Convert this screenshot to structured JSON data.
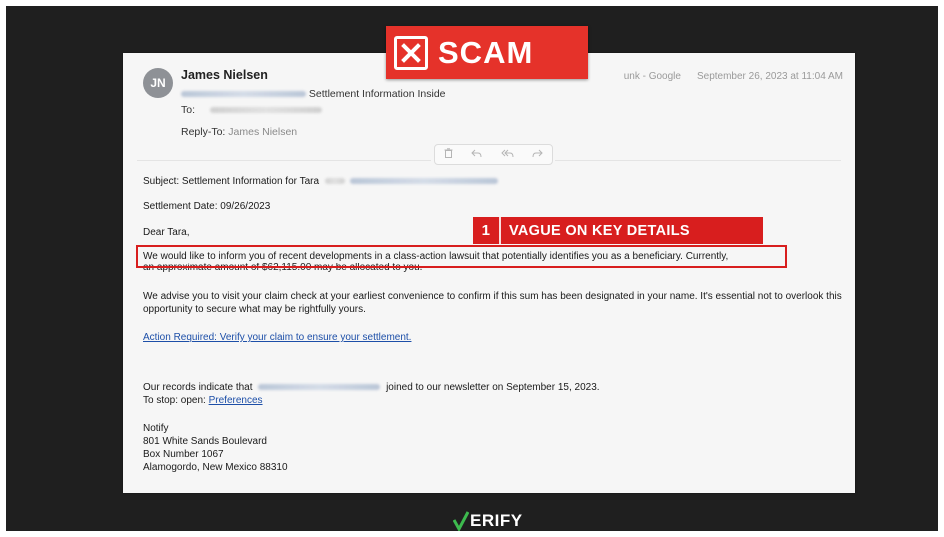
{
  "badge": {
    "scam_label": "SCAM"
  },
  "annotation": {
    "number": "1",
    "label": "VAGUE ON KEY DETAILS"
  },
  "email": {
    "avatar_initials": "JN",
    "sender_name": "James Nielsen",
    "from_meta_partial": "unk - Google",
    "date": "September 26, 2023 at 11:04 AM",
    "subject_preview": "Settlement Information Inside",
    "to_label": "To:",
    "reply_to_label": "Reply-To:",
    "reply_to_value": "James Nielsen",
    "subject_line": "Subject: Settlement Information for Tara",
    "settlement_date": "Settlement Date: 09/26/2023",
    "greeting": "Dear Tara,",
    "para1_highlighted": "We would like to inform you of recent developments in a class-action lawsuit that potentially identifies you as a beneficiary.",
    "para1_rest": "Currently,",
    "para1_line2": "an approximate amount of $62,115.00 may be allocated to you.",
    "para2": "We advise you to visit your claim check at your earliest convenience to confirm if this sum has been designated in your name. It's essential not to overlook this opportunity to secure what may be rightfully yours.",
    "action_link": "Action Required: Verify your claim to ensure your settlement.",
    "records_prefix": "Our records indicate that",
    "records_suffix": "joined to our newsletter on September 15, 2023.",
    "stop_prefix": "To stop: open:",
    "preferences_link": "Preferences",
    "signature": {
      "company": "Notify",
      "address1": "801 White Sands Boulevard",
      "address2": "Box Number 1067",
      "address3": "Alamogordo, New Mexico 88310"
    }
  },
  "brand": {
    "logo_text": "ERIFY"
  },
  "colors": {
    "alert_red": "#d81e1e",
    "link_blue": "#1d4fa8",
    "background_dark": "#1f1f1f"
  },
  "icons": [
    "trash-icon",
    "reply-icon",
    "reply-all-icon",
    "forward-icon",
    "x-box-icon",
    "verify-check-icon"
  ]
}
